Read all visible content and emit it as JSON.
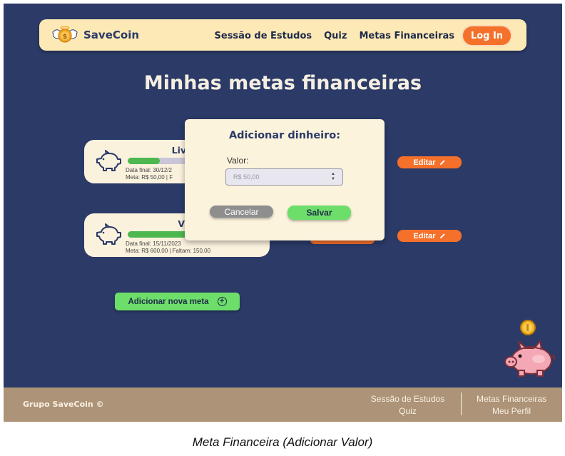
{
  "nav": {
    "brand": "SaveCoin",
    "links": [
      "Sessão de Estudos",
      "Quiz",
      "Metas Financeiras"
    ],
    "login_label": "Log In"
  },
  "page": {
    "title": "Minhas metas financeiras"
  },
  "goals": [
    {
      "name": "Livro de Ci",
      "progress": 0.25,
      "date_line": "Data final: 30/12/2",
      "meta_line": "Meta: R$ 50,00 | F",
      "edit_label": "Editar"
    },
    {
      "name": "Videoga",
      "progress": 0.75,
      "date_line": "Data final: 15/11/2023",
      "meta_line": "Meta: R$ 600,00 | Faltam: 150,00",
      "edit_label": "Editar"
    }
  ],
  "add_goal_label": "Adicionar nova meta",
  "modal": {
    "title": "Adicionar dinheiro:",
    "field_label": "Valor:",
    "field_placeholder": "R$ 50,00",
    "cancel_label": "Cancelar",
    "save_label": "Salvar"
  },
  "footer": {
    "brand": "Grupo SaveCoin ©",
    "col1": [
      "Sessão de Estudos",
      "Quiz"
    ],
    "col2": [
      "Metas Financeiras",
      "Meu Perfil"
    ]
  },
  "caption": "Meta Financeira (Adicionar Valor)",
  "colors": {
    "background": "#2b3a67",
    "navbar": "#fde9b5",
    "accent_orange": "#f5702a",
    "accent_green": "#6dde6a",
    "footer": "#ad9377"
  }
}
